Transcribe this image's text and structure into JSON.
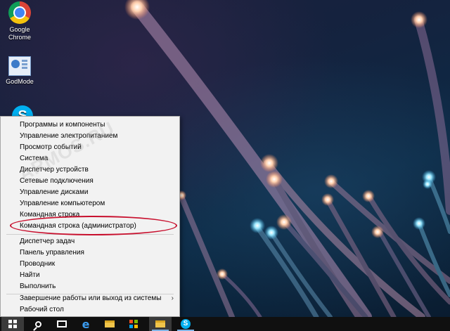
{
  "desktop": {
    "icons": [
      {
        "label_line1": "Google",
        "label_line2": "Chrome",
        "icon": "chrome-icon"
      },
      {
        "label_line1": "GodMode",
        "label_line2": "",
        "icon": "control-panel-icon"
      },
      {
        "label_line1": "",
        "label_line2": "",
        "icon": "skype-icon"
      }
    ],
    "watermark": "ARMOS.RU"
  },
  "context_menu": {
    "items": [
      "Программы и компоненты",
      "Управление электропитанием",
      "Просмотр событий",
      "Система",
      "Диспетчер устройств",
      "Сетевые подключения",
      "Управление дисками",
      "Управление компьютером",
      "Командная строка",
      "Командная строка (администратор)",
      "Диспетчер задач",
      "Панель управления",
      "Проводник",
      "Найти",
      "Выполнить",
      "Завершение работы или выход из системы",
      "Рабочий стол"
    ],
    "highlighted_item": "Командная строка (администратор)",
    "highlight_color": "#c8102e",
    "submenu_arrow": "›"
  },
  "taskbar": {
    "buttons": [
      "start-icon",
      "search-icon",
      "task-view-icon",
      "edge-icon",
      "file-explorer-icon",
      "store-icon",
      "folder-icon",
      "skype-icon"
    ],
    "accent": "#7fb4e6"
  }
}
